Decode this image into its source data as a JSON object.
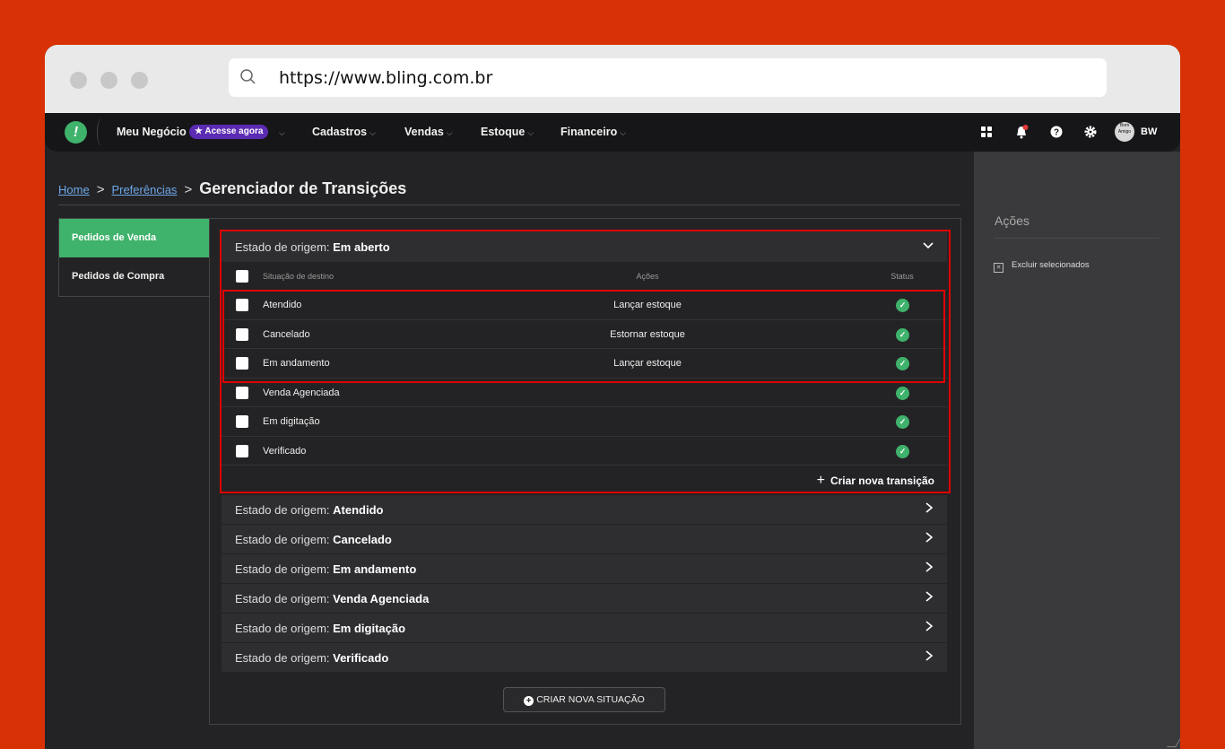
{
  "browser": {
    "url": "https://www.bling.com.br"
  },
  "nav": {
    "logo": "!",
    "business": "Meu Negócio",
    "badge": "Acesse agora",
    "menus": [
      "Cadastros",
      "Vendas",
      "Estoque",
      "Financeiro"
    ],
    "chevron": "⌵",
    "icons": [
      "apps-icon",
      "bell-icon",
      "help-icon",
      "gear-icon"
    ],
    "avatar_text": "Bom Amigo",
    "initials": "BW"
  },
  "breadcrumb": {
    "home": "Home",
    "prefs": "Preferências",
    "separator": ">",
    "current": "Gerenciador de Transições"
  },
  "side_tabs": [
    "Pedidos de Venda",
    "Pedidos de Compra"
  ],
  "open_panel": {
    "prefix": "Estado de origem: ",
    "state": "Em aberto"
  },
  "table": {
    "headers": {
      "situacao": "Situação de destino",
      "acoes": "Ações",
      "status": "Status"
    },
    "rows": [
      {
        "situacao": "Atendido",
        "acao": "Lançar estoque"
      },
      {
        "situacao": "Cancelado",
        "acao": "Estornar estoque"
      },
      {
        "situacao": "Em andamento",
        "acao": "Lançar estoque"
      },
      {
        "situacao": "Venda Agenciada",
        "acao": ""
      },
      {
        "situacao": "Em digitação",
        "acao": ""
      },
      {
        "situacao": "Verificado",
        "acao": ""
      }
    ],
    "check_glyph": "✓",
    "create_label": "Criar nova transição"
  },
  "collapsed_panels": {
    "prefix": "Estado de origem: ",
    "states": [
      "Atendido",
      "Cancelado",
      "Em andamento",
      "Venda Agenciada",
      "Em digitação",
      "Verificado"
    ]
  },
  "new_situation_label": "CRIAR NOVA SITUAÇÃO",
  "actions_panel": {
    "title": "Ações",
    "delete_selected": "Excluir selecionados"
  },
  "colors": {
    "background": "#d93106",
    "accent": "#3fb26b",
    "highlight": "#e00000",
    "badge": "#5b2bb3"
  }
}
